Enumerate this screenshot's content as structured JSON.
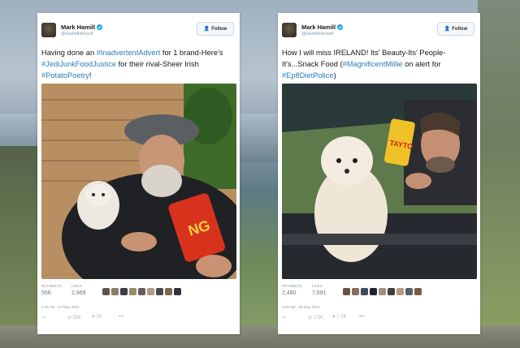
{
  "tweets": [
    {
      "user": "Mark Hamill",
      "handle": "@HamillHimself",
      "follow_label": "Follow",
      "text_parts": [
        {
          "t": "Having done an ",
          "tag": false
        },
        {
          "t": "#InadvertentAdvert",
          "tag": true
        },
        {
          "t": " for 1 brand-Here's ",
          "tag": false
        },
        {
          "t": "#JediJunkFoodJustice",
          "tag": true
        },
        {
          "t": " for their rival-Sheer Irish ",
          "tag": false
        },
        {
          "t": "#PotatoPoetry",
          "tag": true
        },
        {
          "t": "!",
          "tag": false
        }
      ],
      "retweets_label": "RETWEETS",
      "retweets": "556",
      "likes_label": "LIKES",
      "likes": "2,969",
      "time": "5:45 AM - 27 May 2016",
      "reply_count": "",
      "retweet_count": "556",
      "like_count": "3K",
      "more": "•••"
    },
    {
      "user": "Mark Hamill",
      "handle": "@HamillHimself",
      "follow_label": "Follow",
      "text_parts": [
        {
          "t": "How I will miss IRELAND! Its' Beauty-Its' People-It's...Snack Food (",
          "tag": false
        },
        {
          "t": "#MagnificentMillie",
          "tag": true
        },
        {
          "t": " on alert for ",
          "tag": false
        },
        {
          "t": "#Ep8DietPolice",
          "tag": true
        },
        {
          "t": ")",
          "tag": false
        }
      ],
      "retweets_label": "RETWEETS",
      "retweets": "2,480",
      "likes_label": "LIKES",
      "likes": "7,691",
      "time": "3:20 AM - 25 May 2016",
      "reply_count": "",
      "retweet_count": "2.5K",
      "like_count": "7.7K",
      "more": "•••"
    }
  ],
  "icons": [
    "verified-icon",
    "follow-person-icon",
    "reply-icon",
    "retweet-icon",
    "heart-icon",
    "more-icon"
  ],
  "colors": {
    "link": "#2b7bb9",
    "accent": "#1da1f2",
    "verified": "#1da1f2"
  }
}
